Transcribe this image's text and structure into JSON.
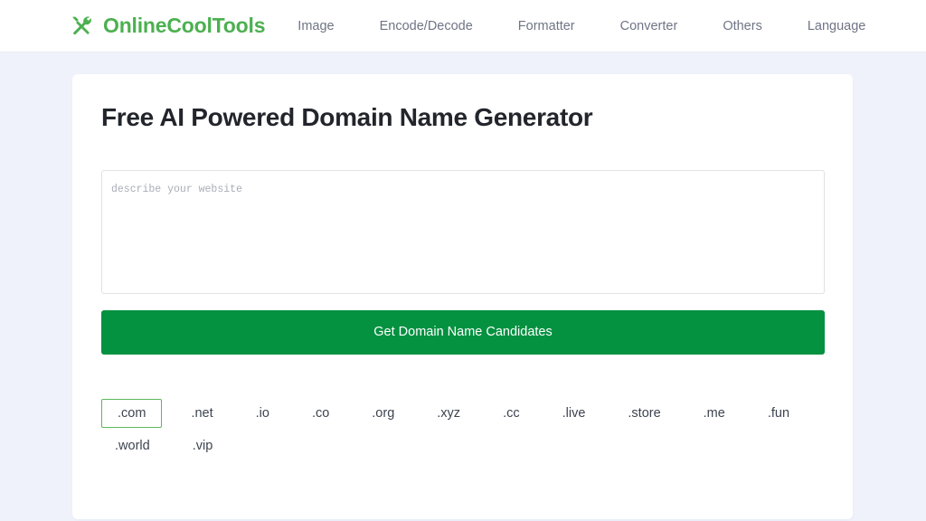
{
  "header": {
    "brand": {
      "icon": "crossed-tools-icon",
      "name": "OnlineCoolTools",
      "color": "#4cb050"
    },
    "nav": [
      {
        "label": "Image"
      },
      {
        "label": "Encode/Decode"
      },
      {
        "label": "Formatter"
      },
      {
        "label": "Converter"
      },
      {
        "label": "Others"
      },
      {
        "label": "Language"
      }
    ]
  },
  "main": {
    "title": "Free AI Powered Domain Name Generator",
    "describe": {
      "value": "",
      "placeholder": "describe your website"
    },
    "submit_label": "Get Domain Name Candidates",
    "tlds": [
      {
        "label": ".com",
        "selected": true
      },
      {
        "label": ".net",
        "selected": false
      },
      {
        "label": ".io",
        "selected": false
      },
      {
        "label": ".co",
        "selected": false
      },
      {
        "label": ".org",
        "selected": false
      },
      {
        "label": ".xyz",
        "selected": false
      },
      {
        "label": ".cc",
        "selected": false
      },
      {
        "label": ".live",
        "selected": false
      },
      {
        "label": ".store",
        "selected": false
      },
      {
        "label": ".me",
        "selected": false
      },
      {
        "label": ".fun",
        "selected": false
      },
      {
        "label": ".world",
        "selected": false
      },
      {
        "label": ".vip",
        "selected": false
      }
    ]
  },
  "colors": {
    "page_background": "#eff2fa",
    "card_background": "#ffffff",
    "brand_green": "#4cb050",
    "button_green": "#049140",
    "selected_chip_border": "#5cb85c",
    "title_text": "#22252b",
    "nav_text": "#6f7585"
  }
}
